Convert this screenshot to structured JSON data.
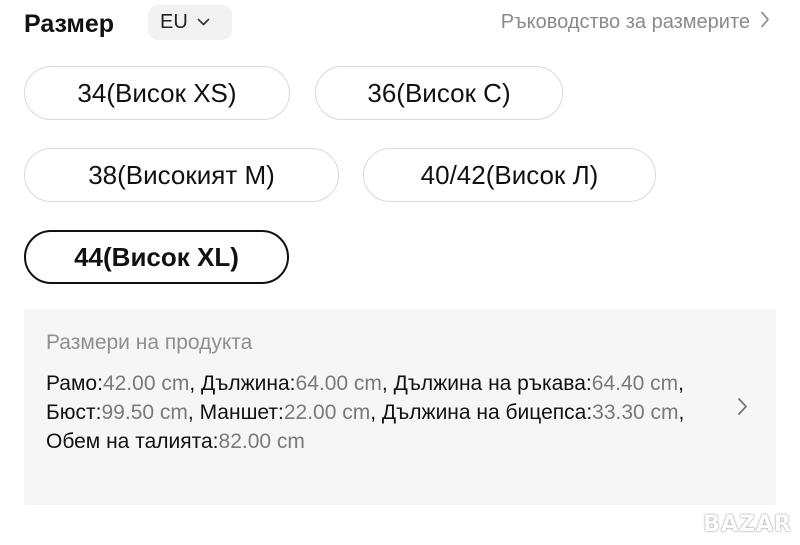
{
  "header": {
    "title": "Размер",
    "region_select": {
      "value": "EU",
      "icon": "chevron-down-icon"
    },
    "size_guide_link": {
      "label": "Ръководство за размерите",
      "icon": "chevron-right-icon"
    }
  },
  "sizes": [
    {
      "label": "34(Висок XS)",
      "selected": false
    },
    {
      "label": "36(Висок С)",
      "selected": false
    },
    {
      "label": "38(Високият М)",
      "selected": false
    },
    {
      "label": "40/42(Висок Л)",
      "selected": false
    },
    {
      "label": "44(Висок XL)",
      "selected": true
    }
  ],
  "product_dimensions": {
    "label": "Размери на продукта",
    "items": [
      {
        "key": "Рамо",
        "value": "42.00 cm"
      },
      {
        "key": "Дължина",
        "value": "64.00 cm"
      },
      {
        "key": "Дължина на ръкава",
        "value": "64.40 cm"
      },
      {
        "key": "Бюст",
        "value": "99.50 cm"
      },
      {
        "key": "Маншет",
        "value": "22.00 cm"
      },
      {
        "key": "Дължина на бицепса",
        "value": "33.30 cm"
      },
      {
        "key": "Обем на талията",
        "value": "82.00 cm"
      }
    ]
  },
  "watermark": "BAZAR",
  "colors": {
    "text_primary": "#111111",
    "text_secondary": "#8a8a8a",
    "chip_border": "#d9d9d9",
    "selected_border": "#111111",
    "panel_background": "#f6f6f6"
  }
}
